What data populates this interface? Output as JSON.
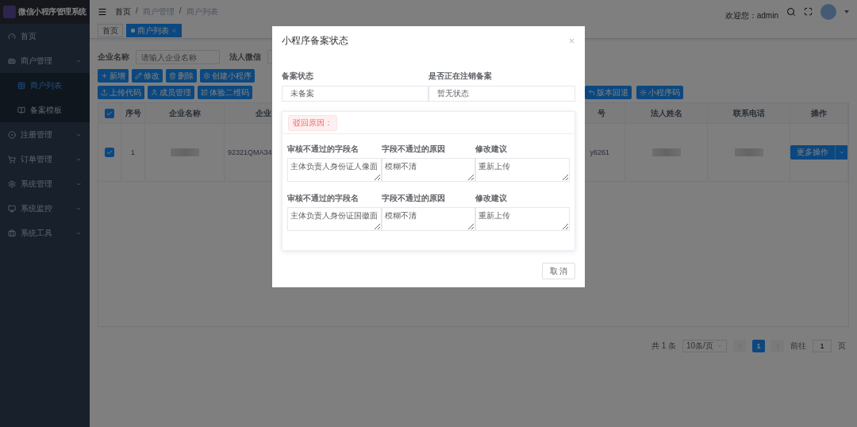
{
  "sidebar": {
    "logo_text": "微信小程序管理系统",
    "items": [
      {
        "label": "首页"
      },
      {
        "label": "商户管理",
        "expanded": true,
        "children": [
          {
            "label": "商户列表",
            "selected": true
          },
          {
            "label": "备案模板",
            "selected": false
          }
        ]
      },
      {
        "label": "注册管理",
        "expanded": false
      },
      {
        "label": "订单管理",
        "expanded": false
      },
      {
        "label": "系统管理",
        "expanded": false
      },
      {
        "label": "系统监控",
        "expanded": false
      },
      {
        "label": "系统工具",
        "expanded": false
      }
    ]
  },
  "header": {
    "breadcrumb": [
      "首页",
      "商户管理",
      "商户列表"
    ],
    "separator": "/",
    "welcome": "欢迎您：admin"
  },
  "tabs": [
    {
      "label": "首页",
      "selected": false
    },
    {
      "label": "商户列表",
      "selected": true
    }
  ],
  "search": [
    {
      "label": "企业名称",
      "placeholder": "请输入企业名称"
    },
    {
      "label": "法人微信"
    }
  ],
  "toolbar": [
    [
      {
        "label": "新增"
      },
      {
        "label": "修改"
      },
      {
        "label": "删除"
      },
      {
        "label": "创建小程序"
      }
    ],
    [
      {
        "label": "上传代码"
      },
      {
        "label": "成员管理"
      },
      {
        "label": "体验二维码"
      }
    ]
  ],
  "toolbar_right": [
    {
      "label": "版本回退"
    },
    {
      "label": "小程序码"
    }
  ],
  "table": {
    "header_checked": true,
    "columns": [
      "序号",
      "企业名称",
      "企业",
      "号",
      "法人姓名",
      "联系电话",
      "操作"
    ],
    "rows": [
      {
        "checked": true,
        "cells": [
          {
            "kind": "text",
            "text": "1"
          },
          {
            "kind": "redacted"
          },
          {
            "kind": "text",
            "text": "92321QMA34"
          },
          {
            "kind": "text",
            "text": "y6261"
          },
          {
            "kind": "redacted"
          },
          {
            "kind": "redacted"
          }
        ],
        "action": "更多操作"
      }
    ]
  },
  "pagination": {
    "total": "共 1 条",
    "page_size": "10条/页",
    "pages": [
      {
        "label": "1",
        "selected": true
      }
    ],
    "goto_label": "前往",
    "goto_value": "1",
    "page_suffix": "页"
  },
  "dialog": {
    "title": "小程序备案状态",
    "fields": [
      {
        "label": "备案状态",
        "value": "未备案"
      },
      {
        "label": "是否正在注销备案",
        "value": "暂无状态"
      }
    ],
    "reject_tag": "驳回原因：",
    "reasons": [
      {
        "field_label": "审核不通过的字段名",
        "field_value": "主体负责人身份证人像面",
        "reason_label": "字段不通过的原因",
        "reason_value": "模糊不清",
        "suggestion_label": "修改建议",
        "suggestion_value": "重新上传"
      },
      {
        "field_label": "审核不通过的字段名",
        "field_value": "主体负责人身份证国徽面",
        "reason_label": "字段不通过的原因",
        "reason_value": "模糊不清",
        "suggestion_label": "修改建议",
        "suggestion_value": "重新上传"
      }
    ],
    "cancel": "取 消"
  }
}
